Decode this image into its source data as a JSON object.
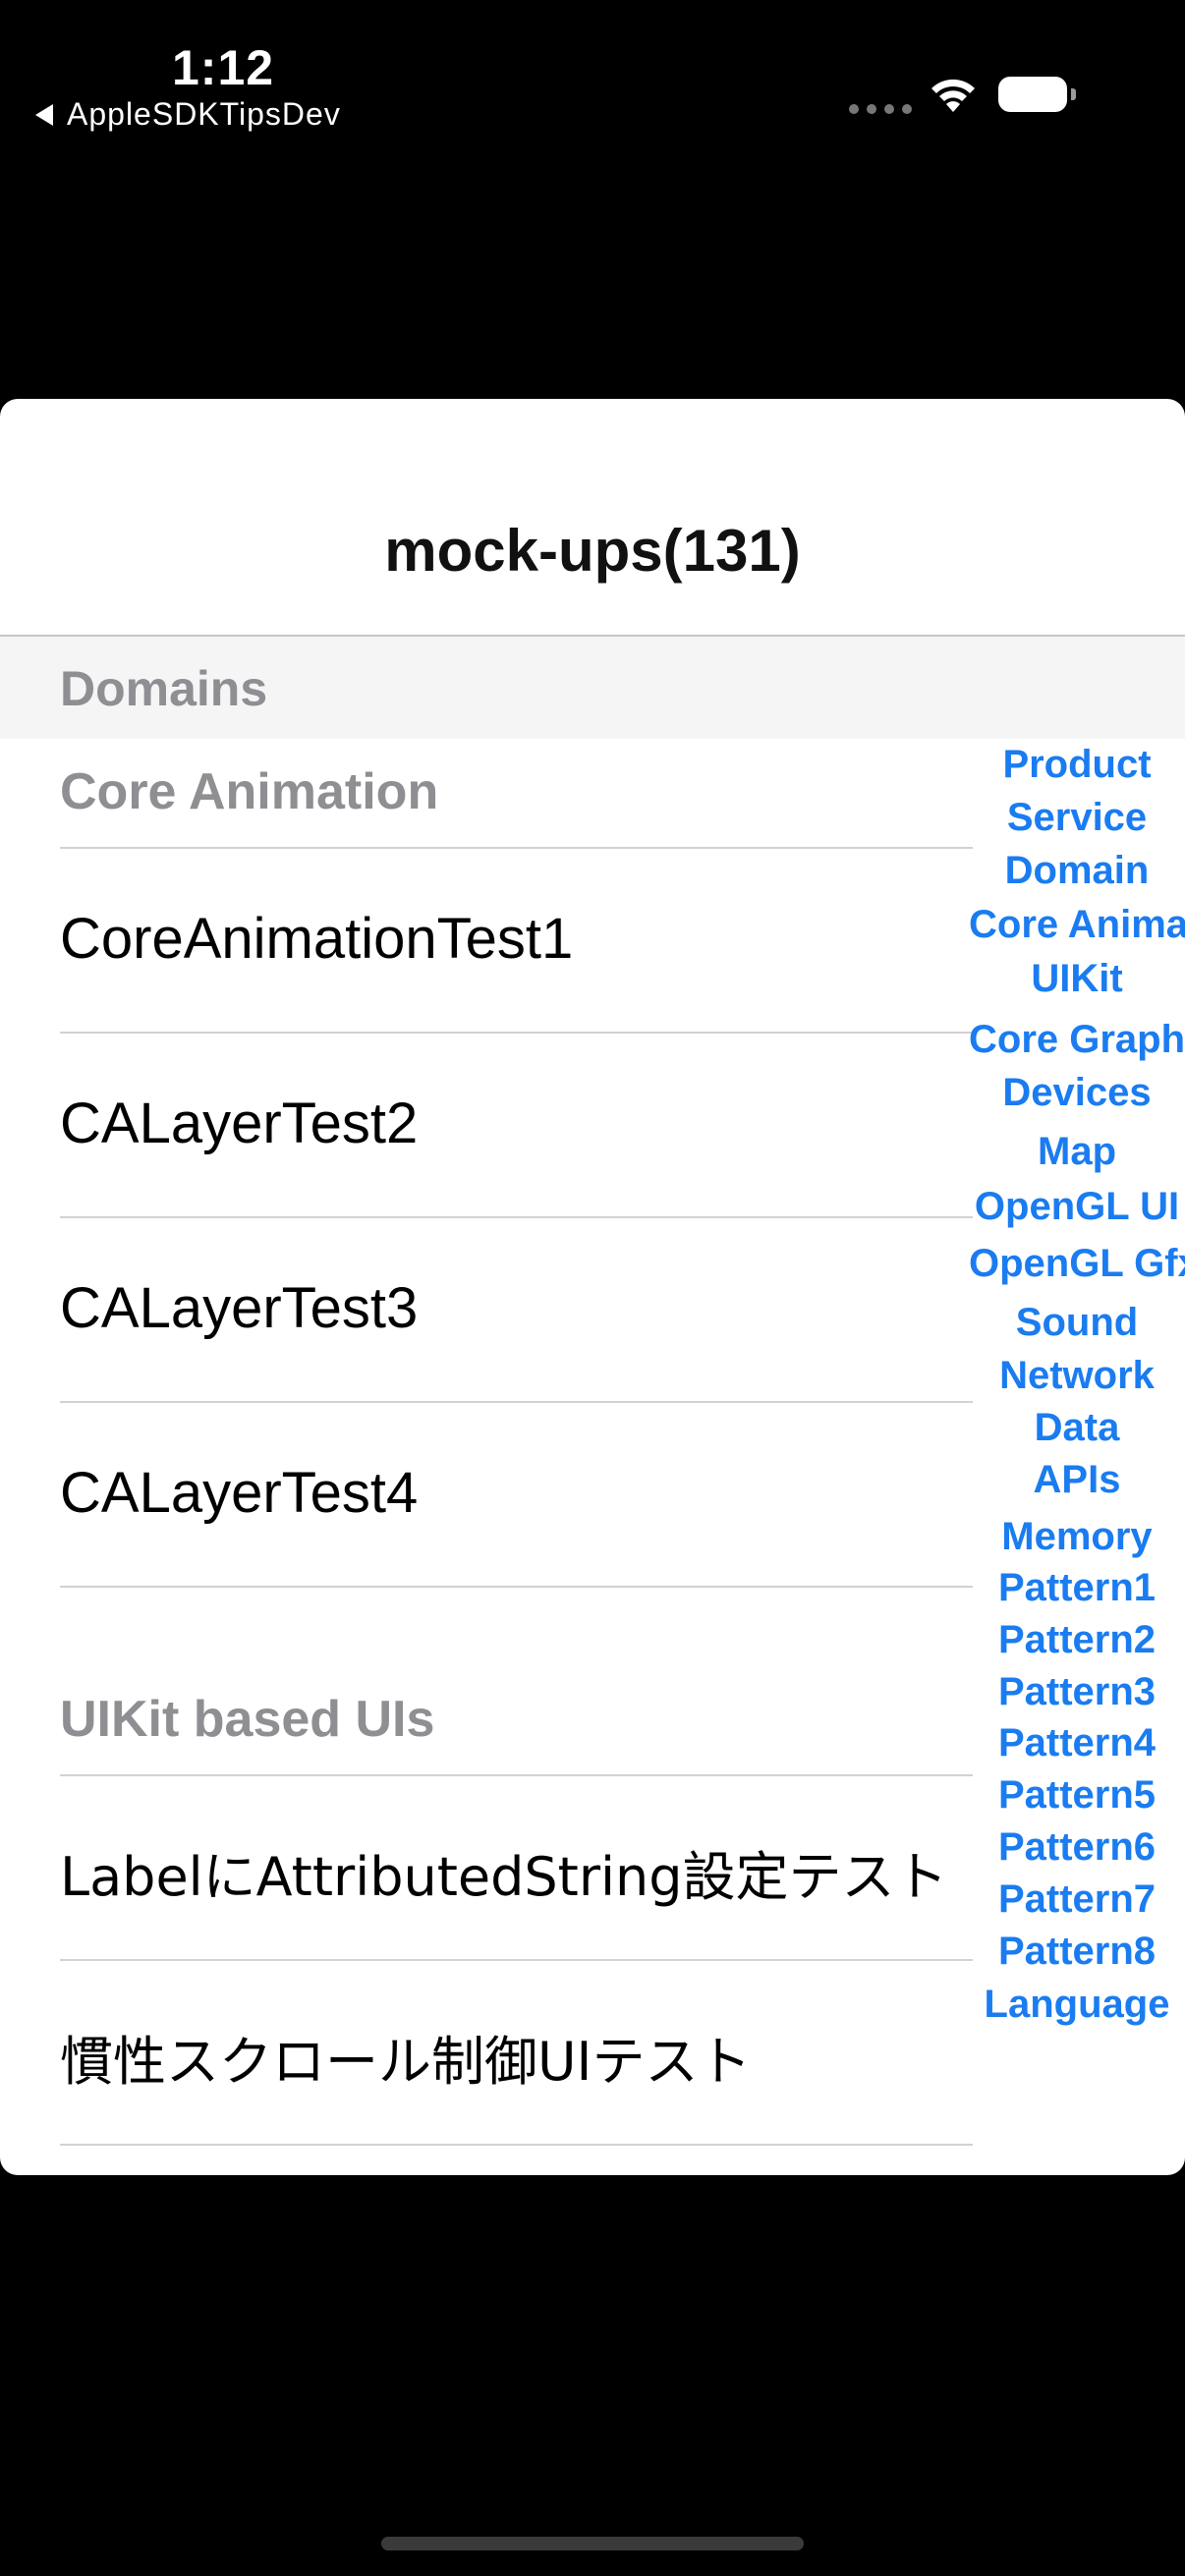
{
  "status_bar": {
    "time": "1:12",
    "back_app": "AppleSDKTipsDev"
  },
  "nav": {
    "title": "mock-ups(131)"
  },
  "sections": {
    "domains_header": "Domains",
    "core_animation_header": "Core Animation",
    "uikit_header": "UIKit based UIs",
    "core_animation_items": [
      {
        "label": "CoreAnimationTest1"
      },
      {
        "label": "CALayerTest2"
      },
      {
        "label": "CALayerTest3"
      },
      {
        "label": "CALayerTest4"
      }
    ],
    "uikit_items": [
      {
        "label": "LabelにAttributedString設定テスト"
      },
      {
        "label": "慣性スクロール制御UIテスト"
      }
    ]
  },
  "index_list": [
    "Product",
    "Service",
    "Domain",
    "Core Animation",
    "UIKit",
    "Core Graphics",
    "Devices",
    "Map",
    "OpenGL UI",
    "OpenGL Gfx",
    "Sound",
    "Network",
    "Data",
    "APIs",
    "Memory",
    "Pattern1",
    "Pattern2",
    "Pattern3",
    "Pattern4",
    "Pattern5",
    "Pattern6",
    "Pattern7",
    "Pattern8",
    "Language"
  ],
  "colors": {
    "accent": "#1a7cf0",
    "section_text": "#8e8e93",
    "background": "#000000",
    "sheet": "#ffffff"
  },
  "icons": [
    "back-triangle-icon",
    "wifi-icon",
    "battery-icon"
  ]
}
